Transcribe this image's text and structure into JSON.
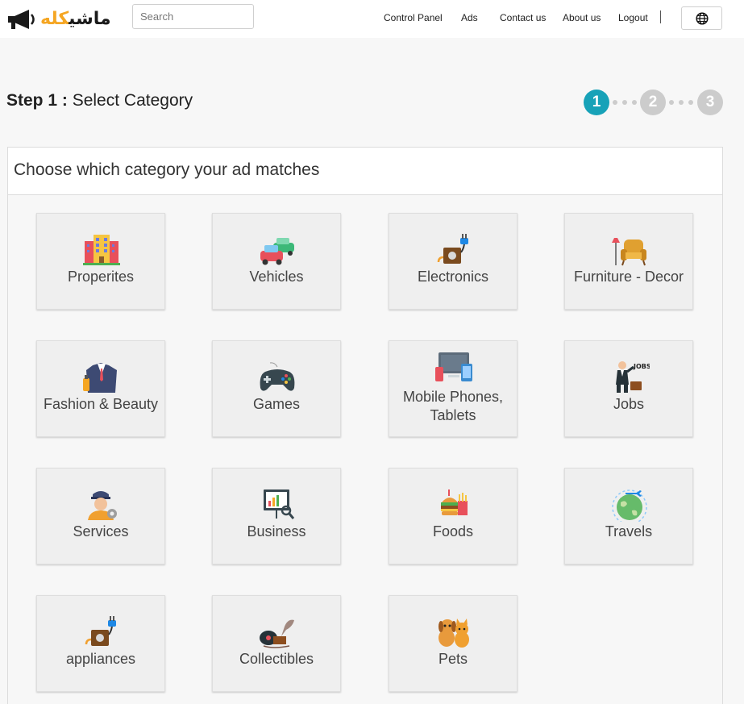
{
  "header": {
    "search_placeholder": "Search",
    "nav": [
      "Control Panel",
      "Ads",
      "Contact us",
      "About us",
      "Logout"
    ]
  },
  "step": {
    "label": "Step 1 :",
    "title": "Select Category",
    "numbers": [
      "1",
      "2",
      "3"
    ],
    "current": 1
  },
  "panel": {
    "heading": "Choose which category your ad matches"
  },
  "categories": [
    {
      "label": "Properites",
      "icon": "building-icon"
    },
    {
      "label": "Vehicles",
      "icon": "cars-icon"
    },
    {
      "label": "Electronics",
      "icon": "plug-icon"
    },
    {
      "label": "Furniture - Decor",
      "icon": "armchair-icon"
    },
    {
      "label": "Fashion & Beauty",
      "icon": "suit-icon"
    },
    {
      "label": "Games",
      "icon": "gamepad-icon"
    },
    {
      "label": "Mobile Phones, Tablets",
      "icon": "devices-icon"
    },
    {
      "label": "Jobs",
      "icon": "businessman-icon"
    },
    {
      "label": "Services",
      "icon": "worker-icon"
    },
    {
      "label": "Business",
      "icon": "chart-board-icon"
    },
    {
      "label": "Foods",
      "icon": "burger-icon"
    },
    {
      "label": "Travels",
      "icon": "globe-plane-icon"
    },
    {
      "label": "appliances",
      "icon": "plug-icon"
    },
    {
      "label": "Collectibles",
      "icon": "gramophone-icon"
    },
    {
      "label": "Pets",
      "icon": "pets-icon"
    }
  ],
  "colors": {
    "accent": "#17a2b8",
    "step_inactive": "#cccccc",
    "logo_orange": "#f5a623"
  }
}
